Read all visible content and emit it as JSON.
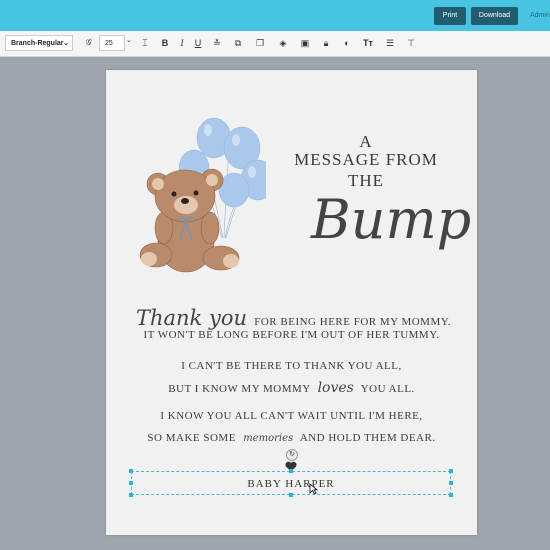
{
  "header": {
    "print_label": "Print",
    "download_label": "Download",
    "admin_label": "Admin"
  },
  "toolbar": {
    "font_name": "Branch-Regular",
    "font_size": "25"
  },
  "card": {
    "title_line1": "A",
    "title_line2": "MESSAGE FROM",
    "title_line3": "THE",
    "title_script": "Bump",
    "line1_script": "Thank you",
    "line1_text": "FOR BEING HERE FOR MY MOMMY.",
    "line2": "IT WON'T BE LONG BEFORE I'M OUT OF HER TUMMY.",
    "line3": "I CAN'T BE THERE TO THANK YOU ALL,",
    "line4_pre": "BUT I KNOW MY MOMMY",
    "line4_script": "loves",
    "line4_post": "YOU ALL.",
    "line5": "I KNOW YOU ALL CAN'T WAIT UNTIL I'M HERE,",
    "line6_pre": "SO MAKE SOME",
    "line6_script": "memories",
    "line6_post": "AND HOLD THEM DEAR.",
    "baby_name": "BABY HARPER"
  },
  "colors": {
    "header": "#47c4e2",
    "header_button": "#215d6e",
    "balloon": "#a9c8ec",
    "selection": "#2fb2d6"
  },
  "icons": [
    "type-icon",
    "text-height-icon",
    "bold-icon",
    "italic-icon",
    "underline-icon",
    "align-icon",
    "image-icon",
    "copy-icon",
    "layers-icon",
    "duplicate-icon",
    "lock-icon",
    "fill-icon",
    "text-style-icon",
    "line-spacing-icon",
    "text-transform-icon",
    "heart-icon",
    "rotate-icon"
  ]
}
